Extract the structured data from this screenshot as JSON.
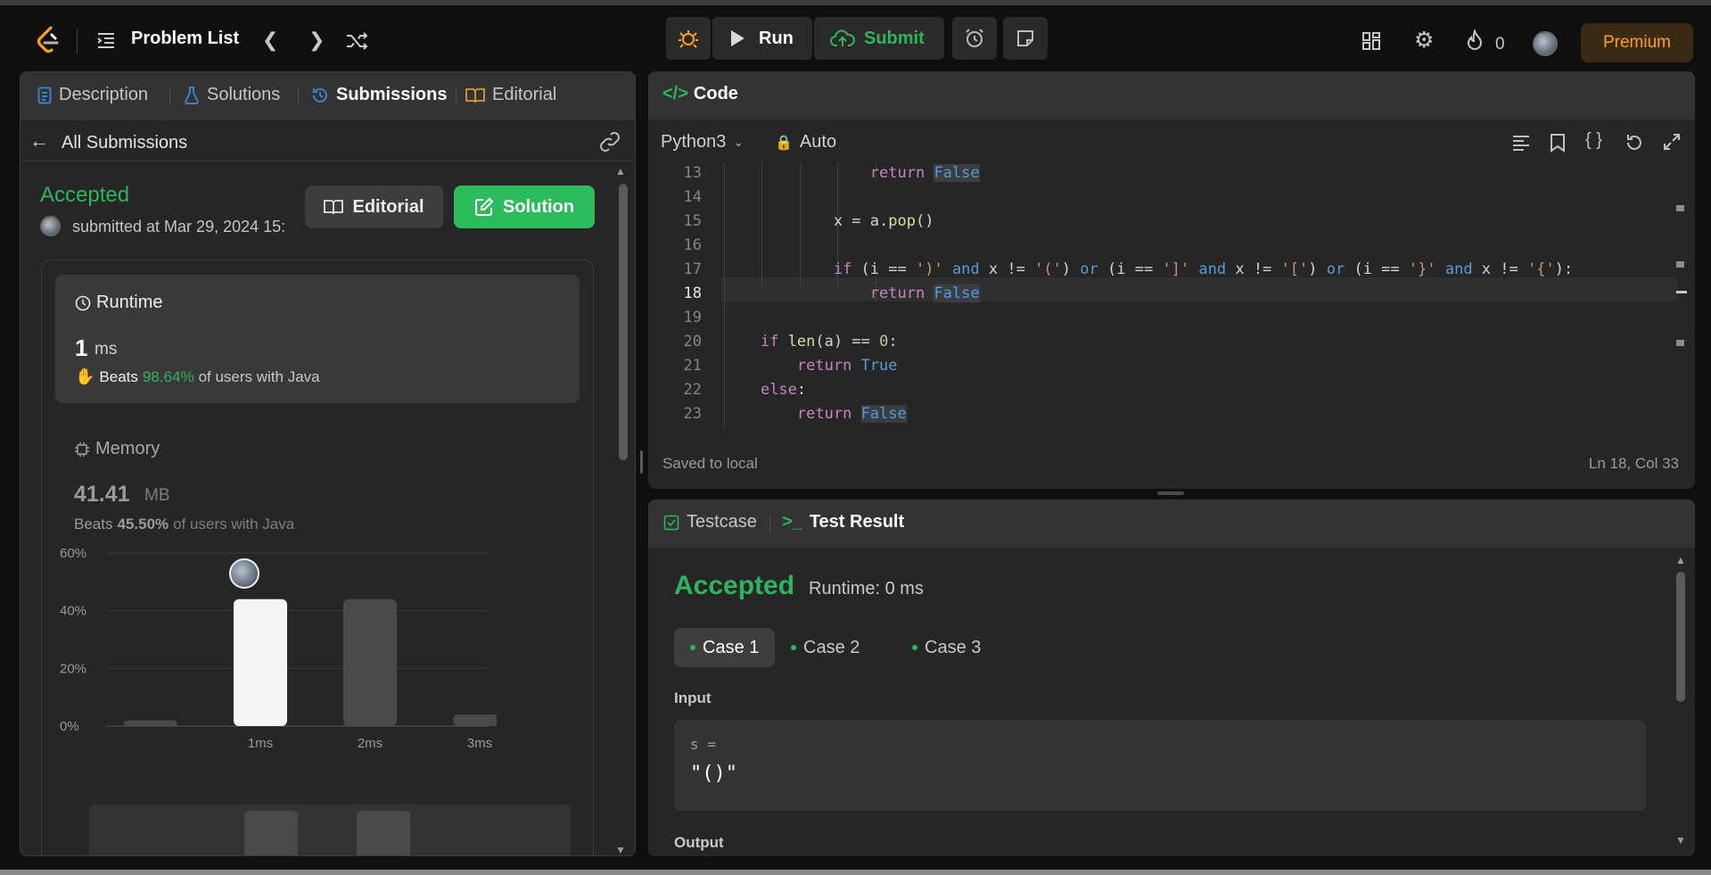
{
  "nav": {
    "title": "Problem List",
    "run_label": "Run",
    "submit_label": "Submit",
    "streak_count": "0",
    "premium_label": "Premium"
  },
  "left": {
    "tabs": [
      {
        "label": "Description",
        "icon": "description-icon"
      },
      {
        "label": "Solutions",
        "icon": "flask-icon"
      },
      {
        "label": "Submissions",
        "icon": "history-icon"
      },
      {
        "label": "Editorial",
        "icon": "book-icon"
      }
    ],
    "back_label": "All Submissions",
    "status": "Accepted",
    "submitted_text": "submitted at Mar 29, 2024 15:",
    "editorial_btn": "Editorial",
    "solution_btn": "Solution",
    "runtime": {
      "label": "Runtime",
      "value": "1",
      "unit": "ms",
      "beats_prefix": "Beats",
      "beats_pct": "98.64%",
      "beats_suffix": "of users with Java"
    },
    "memory": {
      "label": "Memory",
      "value": "41.41",
      "unit": "MB",
      "beats_prefix": "Beats",
      "beats_pct": "45.50%",
      "beats_suffix": "of users with Java"
    }
  },
  "chart_data": {
    "type": "bar",
    "categories": [
      "",
      "1ms",
      "2ms",
      "3ms"
    ],
    "values": [
      2,
      44,
      44,
      4
    ],
    "highlight_index": 1,
    "ylim": [
      0,
      60
    ],
    "yticks": [
      "60%",
      "40%",
      "20%",
      "0%"
    ],
    "ytick_values": [
      60,
      40,
      20,
      0
    ],
    "grid": true,
    "colors": {
      "highlight": "#f5f5f5",
      "bar": "#4a4a4a"
    }
  },
  "code": {
    "header": "Code",
    "language": "Python3",
    "mode": "Auto",
    "saved_text": "Saved to local",
    "cursor_pos": "Ln 18, Col 33",
    "line_numbers": [
      "13",
      "14",
      "15",
      "16",
      "17",
      "18",
      "19",
      "20",
      "21",
      "22",
      "23"
    ]
  },
  "result": {
    "tab_testcase": "Testcase",
    "tab_result": "Test Result",
    "status": "Accepted",
    "runtime_text": "Runtime: 0 ms",
    "cases": [
      "Case 1",
      "Case 2",
      "Case 3"
    ],
    "input_label": "Input",
    "input_var": "s =",
    "input_value": "\"()\"",
    "output_label": "Output"
  },
  "colors": {
    "accent_green": "#2db55d",
    "premium": "#ffa116",
    "panel_bg": "#262626"
  }
}
